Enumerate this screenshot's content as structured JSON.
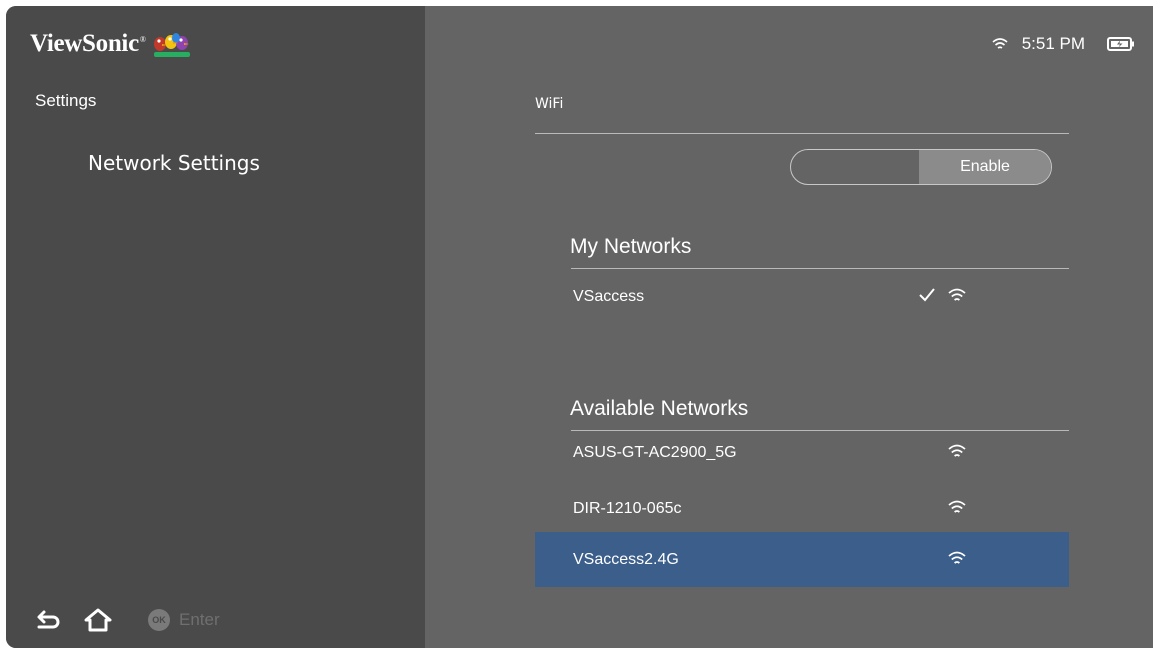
{
  "brand": {
    "name": "ViewSonic",
    "trademark": "®"
  },
  "sidebar": {
    "title": "Settings",
    "items": [
      {
        "label": "Network Settings"
      }
    ]
  },
  "footer": {
    "back_icon": "back-arrow-icon",
    "home_icon": "home-icon",
    "ok_badge": "OK",
    "enter_label": "Enter"
  },
  "status_bar": {
    "time": "5:51 PM",
    "wifi_icon": "wifi-icon",
    "battery_icon": "battery-charging-icon"
  },
  "wifi": {
    "title": "WiFi",
    "toggle": {
      "on_label": "Enable",
      "state": "enabled"
    }
  },
  "my_networks": {
    "title": "My Networks",
    "items": [
      {
        "name": "VSaccess",
        "connected": true
      }
    ]
  },
  "available_networks": {
    "title": "Available Networks",
    "items": [
      {
        "name": "ASUS-GT-AC2900_5G"
      },
      {
        "name": "DIR-1210-065c"
      },
      {
        "name": "VSaccess2.4G",
        "selected": true
      }
    ]
  },
  "colors": {
    "left_panel": "#4a4a4a",
    "right_panel": "#646464",
    "selection": "#3b5e8a",
    "toggle_on": "#8b8b8b"
  }
}
